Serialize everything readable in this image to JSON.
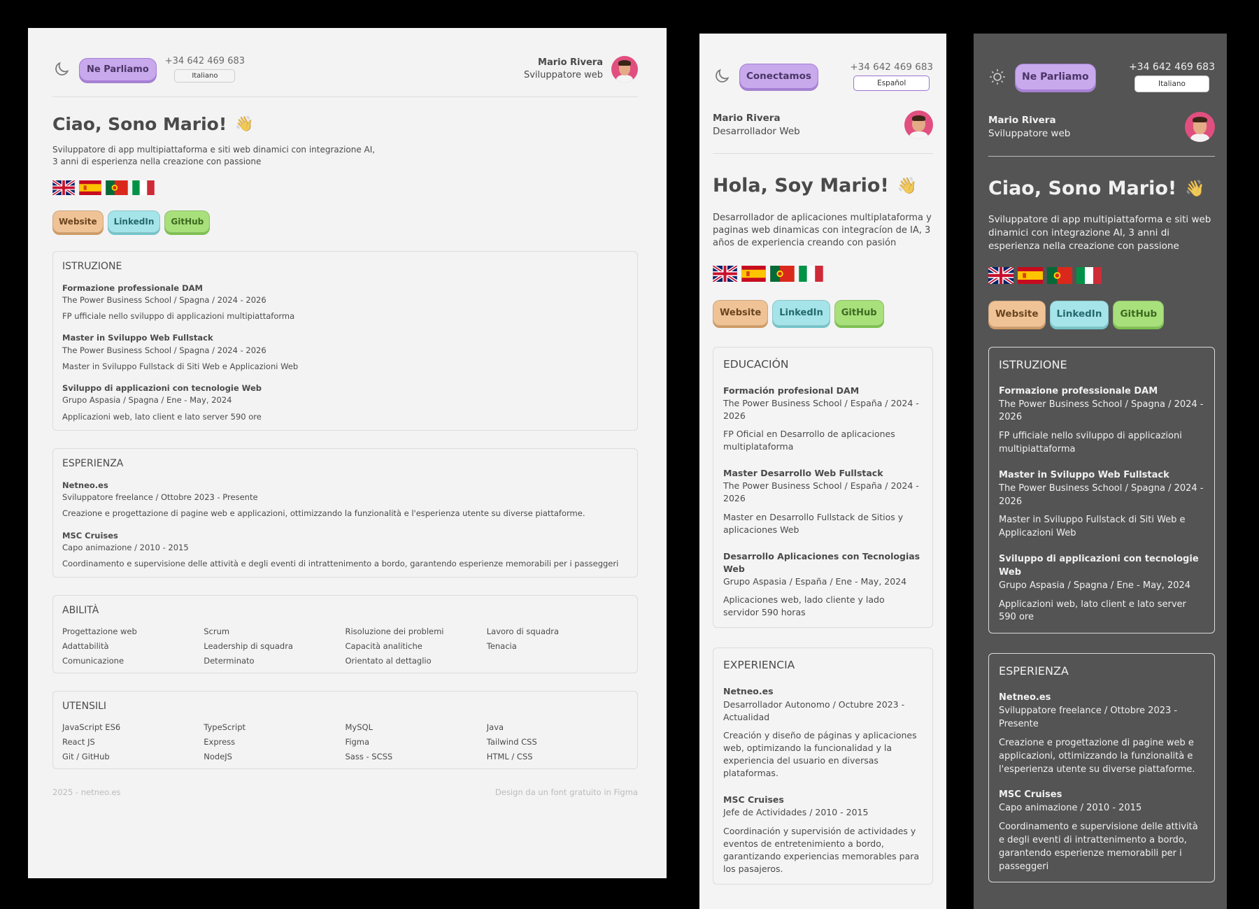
{
  "colors": {
    "accent": "#c8a9ec",
    "website": "#f0c396",
    "linkedin": "#a5e5ea",
    "github": "#a8e07b",
    "dark_bg": "#545454",
    "light_bg": "#f3f3f4",
    "avatar": "#e14f7f"
  },
  "icons": {
    "light_theme": "moon-icon",
    "dark_theme": "sun-icon"
  },
  "it": {
    "cta": "Ne Parliamo",
    "phone": "+34 642 469 683",
    "lang": "Italiano",
    "name": "Mario Rivera",
    "role": "Sviluppatore web",
    "greeting": "Ciao, Sono Mario!",
    "wave": "👋",
    "intro": "Sviluppatore di app multipiattaforma e siti web dinamici con integrazione AI, 3 anni di esperienza nella creazione con passione",
    "intro_l1": "Sviluppatore di app multipiattaforma e siti web dinamici con integrazione AI,",
    "intro_l2": "3 anni di esperienza nella creazione con passione",
    "links": [
      "Website",
      "LinkedIn",
      "GitHub"
    ],
    "education_title": "ISTRUZIONE",
    "education": [
      {
        "title": "Formazione professionale DAM",
        "meta": "The Power Business School / Spagna / 2024 - 2026",
        "desc": "FP ufficiale nello sviluppo di applicazioni multipiattaforma"
      },
      {
        "title": "Master in Sviluppo Web Fullstack",
        "meta": "The Power Business School / Spagna / 2024 - 2026",
        "desc": "Master in Sviluppo Fullstack di Siti Web e Applicazioni Web"
      },
      {
        "title": "Sviluppo di applicazioni con tecnologie Web",
        "meta": "Grupo Aspasia / Spagna / Ene - May, 2024",
        "desc": "Applicazioni web, lato client e lato server 590 ore"
      }
    ],
    "experience_title": "ESPERIENZA",
    "experience": [
      {
        "title": "Netneo.es",
        "meta": "Sviluppatore freelance / Ottobre 2023 - Presente",
        "desc": "Creazione e progettazione di pagine web e applicazioni, ottimizzando la funzionalità e l'esperienza utente su diverse piattaforme."
      },
      {
        "title": "MSC Cruises",
        "meta": "Capo animazione / 2010 - 2015",
        "desc": "Coordinamento e supervisione delle attività e degli eventi di intrattenimento a bordo, garantendo esperienze memorabili per i passeggeri"
      }
    ],
    "skills_title": "ABILITÀ",
    "skills": [
      "Progettazione web",
      "Scrum",
      "Risoluzione dei problemi",
      "Lavoro di squadra",
      "Adattabilità",
      "Leadership di squadra",
      "Capacità analitiche",
      "Tenacia",
      "Comunicazione",
      "Determinato",
      "Orientato al dettaglio"
    ],
    "tools_title": "UTENSILI",
    "tools": [
      "JavaScript ES6",
      "TypeScript",
      "MySQL",
      "Java",
      "React JS",
      "Express",
      "Figma",
      "Tailwind CSS",
      "Git / GitHub",
      "NodeJS",
      "Sass - SCSS",
      "HTML / CSS"
    ],
    "footer_left": "2025 - netneo.es",
    "footer_right": "Design da un font gratuito in Figma"
  },
  "es": {
    "cta": "Conectamos",
    "phone": "+34 642 469 683",
    "lang": "Español",
    "name": "Mario Rivera",
    "role": "Desarrollador Web",
    "greeting": "Hola, Soy Mario!",
    "wave": "👋",
    "intro": "Desarrollador de aplicaciones multiplataforma y paginas web dinamicas con integracíon de IA, 3 años de experiencia creando con pasión",
    "links": [
      "Website",
      "LinkedIn",
      "GitHub"
    ],
    "education_title": "EDUCACIÓN",
    "education": [
      {
        "title": "Formación profesional DAM",
        "meta": "The Power Business School / España / 2024 - 2026",
        "desc": "FP Oficial en Desarrollo de aplicaciones multiplataforma"
      },
      {
        "title": "Master Desarrollo Web Fullstack",
        "meta": "The Power Business School / España / 2024 - 2026",
        "desc": "Master en Desarrollo Fullstack de Sitios y aplicaciones Web"
      },
      {
        "title": "Desarrollo Aplicaciones con Tecnologias Web",
        "meta": "Grupo Aspasia / España / Ene - May, 2024",
        "desc": "Aplicaciones web, lado cliente y lado servidor 590 horas"
      }
    ],
    "experience_title": "EXPERIENCIA",
    "experience": [
      {
        "title": "Netneo.es",
        "meta": "Desarrollador Autonomo / Octubre 2023 - Actualidad",
        "desc": "Creación y diseño de páginas y aplicaciones web, optimizando la funcionalidad y la experiencia del usuario en diversas plataformas."
      },
      {
        "title": "MSC Cruises",
        "meta": "Jefe de Actividades / 2010 - 2015",
        "desc": "Coordinación y supervisión de actividades y eventos de entretenimiento a bordo, garantizando experiencias memorables para los pasajeros."
      }
    ]
  },
  "dark": {
    "cta": "Ne Parliamo",
    "phone": "+34 642 469 683",
    "lang": "Italiano",
    "name": "Mario Rivera",
    "role": "Sviluppatore web",
    "greeting": "Ciao, Sono Mario!",
    "wave": "👋",
    "intro": "Sviluppatore di app multipiattaforma e siti web dinamici con integrazione AI, 3 anni di esperienza nella creazione con passione",
    "links": [
      "Website",
      "LinkedIn",
      "GitHub"
    ],
    "education_title": "ISTRUZIONE",
    "education": [
      {
        "title": "Formazione professionale DAM",
        "meta": "The Power Business School / Spagna / 2024 - 2026",
        "desc": "FP ufficiale nello sviluppo di applicazioni multipiattaforma"
      },
      {
        "title": "Master in Sviluppo Web Fullstack",
        "meta": "The Power Business School / Spagna / 2024 - 2026",
        "desc": "Master in Sviluppo Fullstack di Siti Web e Applicazioni Web"
      },
      {
        "title": "Sviluppo di applicazioni con tecnologie Web",
        "meta": "Grupo Aspasia / Spagna / Ene - May, 2024",
        "desc": "Applicazioni web, lato client e lato server 590 ore"
      }
    ],
    "experience_title": "ESPERIENZA",
    "experience": [
      {
        "title": "Netneo.es",
        "meta": "Sviluppatore freelance / Ottobre 2023 - Presente",
        "desc": "Creazione e progettazione di pagine web e applicazioni, ottimizzando la funzionalità e l'esperienza utente su diverse piattaforme."
      },
      {
        "title": "MSC Cruises",
        "meta": "Capo animazione / 2010 - 2015",
        "desc": "Coordinamento e supervisione delle attività e degli eventi di intrattenimento a bordo, garantendo esperienze memorabili per i passeggeri"
      }
    ]
  }
}
